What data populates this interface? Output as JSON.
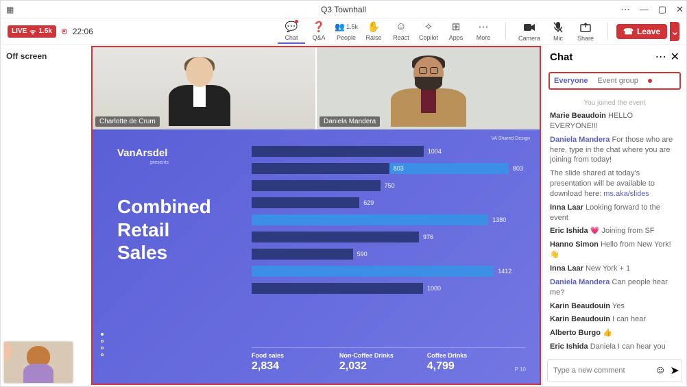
{
  "title": "Q3 Townhall",
  "live_badge": {
    "label": "LIVE",
    "count": "1.5k"
  },
  "timer": "22:06",
  "toolbar": [
    {
      "id": "chat",
      "label": "Chat",
      "icon": "💬",
      "active": true,
      "notif": true
    },
    {
      "id": "qa",
      "label": "Q&A",
      "icon": "❓"
    },
    {
      "id": "people",
      "label": "People",
      "icon": "👥",
      "top": "1.5k"
    },
    {
      "id": "raise",
      "label": "Raise",
      "icon": "✋"
    },
    {
      "id": "react",
      "label": "React",
      "icon": "☺"
    },
    {
      "id": "copilot",
      "label": "Copilot",
      "icon": "✧"
    },
    {
      "id": "apps",
      "label": "Apps",
      "icon": "⊞"
    },
    {
      "id": "more",
      "label": "More",
      "icon": "⋯"
    }
  ],
  "device_buttons": [
    {
      "id": "camera",
      "label": "Camera",
      "icon": "■"
    },
    {
      "id": "mic",
      "label": "Mic",
      "icon": "🎤",
      "muted": true
    },
    {
      "id": "share",
      "label": "Share",
      "icon": "↥"
    }
  ],
  "leave_label": "Leave",
  "offscreen_label": "Off screen",
  "speakers": [
    {
      "name": "Charlotte de Crum"
    },
    {
      "name": "Daniela Mandera"
    }
  ],
  "slide": {
    "brand": "VanArsdel",
    "brand_sub": "presents",
    "tag": "VA Shared Design",
    "title_lines": [
      "Combined",
      "Retail",
      "Sales"
    ],
    "footer": [
      {
        "cap": "Food sales",
        "num": "2,834"
      },
      {
        "cap": "Non-Coffee Drinks",
        "num": "2,032"
      },
      {
        "cap": "Coffee Drinks",
        "num": "4,799"
      }
    ],
    "page": "P 10"
  },
  "chart_data": {
    "type": "bar",
    "orientation": "horizontal",
    "xlim": [
      0,
      1600
    ],
    "bars": [
      {
        "value": 1004,
        "series": "dark"
      },
      {
        "value": 803,
        "series": "dark",
        "label_right": "803"
      },
      {
        "value": 750,
        "series": "dark"
      },
      {
        "value": 629,
        "series": "dark"
      },
      {
        "value": 1380,
        "series": "light"
      },
      {
        "value": 976,
        "series": "dark"
      },
      {
        "value": 590,
        "series": "dark"
      },
      {
        "value": 1412,
        "series": "light"
      },
      {
        "value": 1000,
        "series": "dark"
      }
    ],
    "second_row_wide": {
      "value": 803,
      "series": "light"
    }
  },
  "chat": {
    "title": "Chat",
    "tabs": [
      {
        "label": "Everyone",
        "active": true
      },
      {
        "label": "Event group",
        "notif": true
      }
    ],
    "system": "You joined the event",
    "messages": [
      {
        "name": "Marie Beaudoin",
        "text": "HELLO EVERYONE!!!"
      },
      {
        "name": "Daniela Mandera",
        "link": true,
        "text": "For those who are here, type in the chat where you are joining from today!"
      },
      {
        "plain": "The slide shared at today's presentation will be available to download here: ",
        "link_text": "ms.aka/slides"
      },
      {
        "name": "Inna Laar",
        "text": "Looking forward to the event"
      },
      {
        "name": "Eric Ishida",
        "emoji": "💗",
        "text": "Joining from SF"
      },
      {
        "name": "Hanno Simon",
        "text": "Hello from New York!",
        "tail": "👋"
      },
      {
        "name": "Inna Laar",
        "text": "New York + 1"
      },
      {
        "name": "Daniela Mandera",
        "link": true,
        "text": "Can people hear me?"
      },
      {
        "name": "Karin Beaudouin",
        "text": "Yes"
      },
      {
        "name": "Karin Beaudouin",
        "text": "I can hear"
      },
      {
        "name": "Alberto Burgo",
        "emoji": "👍",
        "text": ""
      },
      {
        "name": "Eric Ishida",
        "text": "Daniela I can hear you"
      }
    ],
    "placeholder": "Type a new comment"
  }
}
